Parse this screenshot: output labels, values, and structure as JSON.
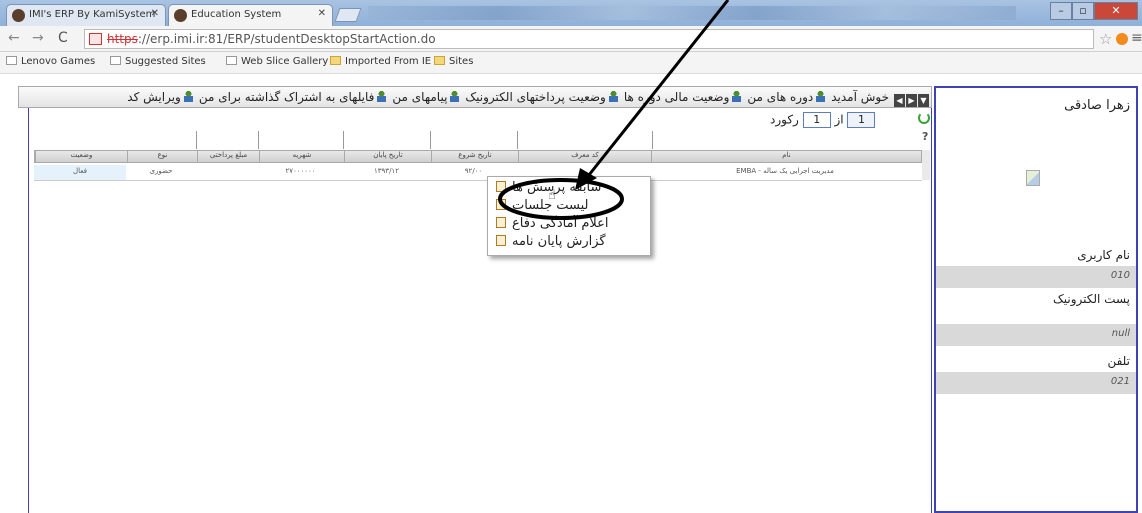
{
  "browser": {
    "tabs": [
      {
        "title": "IMI's ERP By KamiSystem",
        "active": false
      },
      {
        "title": "Education System",
        "active": true
      }
    ],
    "address": {
      "scheme": "https",
      "rest": "://erp.imi.ir:81/ERP/studentDesktopStartAction.do"
    },
    "bookmarks": [
      "Lenovo Games",
      "Suggested Sites",
      "Web Slice Gallery",
      "Imported From IE",
      "Sites"
    ],
    "window_controls": {
      "minimize": "–",
      "maximize": "▫",
      "close": "✕"
    }
  },
  "sidebar": {
    "user_name": "زهرا صادقی",
    "fields": [
      {
        "label": "نام کاربری",
        "value": "010"
      },
      {
        "label": "پست الکترونیک",
        "value": "null"
      },
      {
        "label": "تلفن",
        "value": "021"
      }
    ]
  },
  "menubar": {
    "items": [
      "خوش آمدید",
      "دوره های من",
      "وضعیت مالی دوره ها",
      "وضعیت پرداختهای الکترونیک",
      "پیامهای من",
      "فایلهای به اشتراک گذاشته برای من",
      "ویرایش کد"
    ]
  },
  "pager": {
    "current": "1",
    "of_label": "از",
    "total": "1",
    "records_label": "رکورد"
  },
  "grid": {
    "columns": [
      "نام",
      "کد معرف",
      "تاریخ شروع",
      "تاریخ پایان",
      "شهریه",
      "مبلغ پرداختی",
      "نوع",
      "وضعیت"
    ],
    "rows": [
      {
        "name": "مدیریت اجرایی یک ساله - EMBA",
        "code": "",
        "start": "۹۲/۰۰",
        "end": "۱۳۹۳/۱۲",
        "fee": "۲۷۰۰۰۰۰۰",
        "paid": "",
        "type": "حضوری",
        "status": "فعال"
      }
    ]
  },
  "context_menu": {
    "items": [
      "سابقه پرسش ها",
      "لیست جلسات",
      "اعلام آمادگی دفاع",
      "گزارش پایان نامه"
    ]
  },
  "colors": {
    "panel_border": "#3d42b4",
    "annotation": "#000000"
  }
}
